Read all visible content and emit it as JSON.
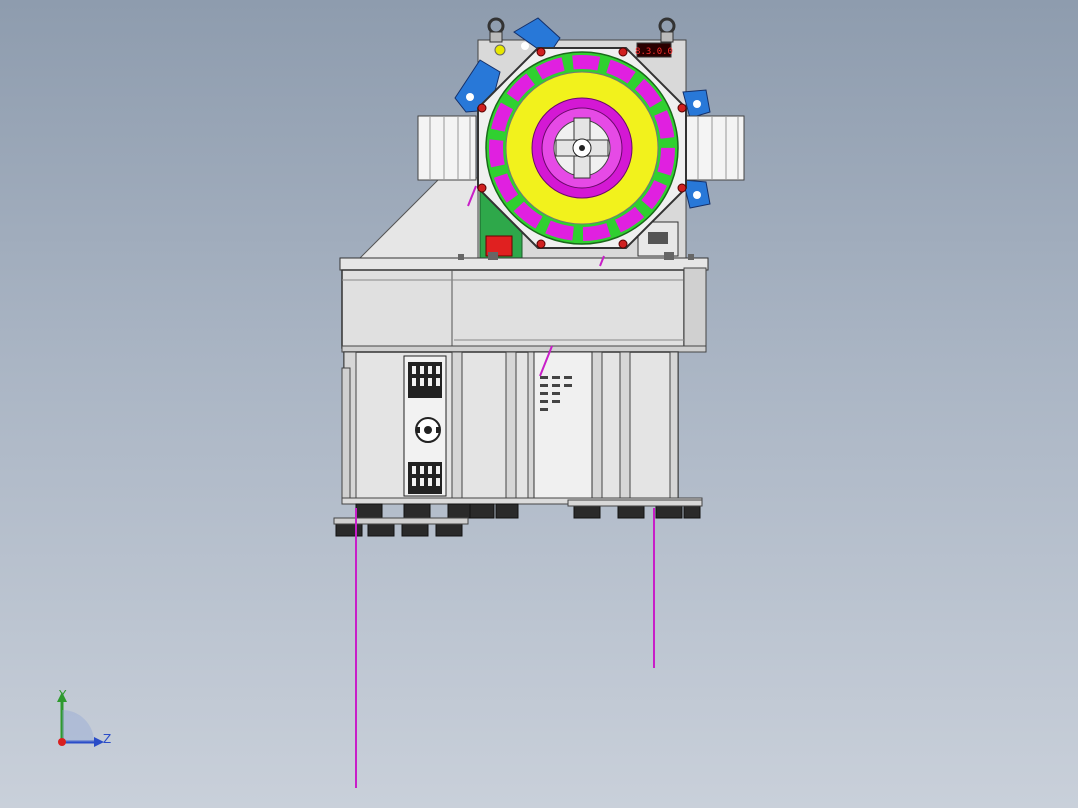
{
  "viewport": {
    "background_top": "#8e9cae",
    "background_bottom": "#c9d0da"
  },
  "model": {
    "parts": [
      "lifting-eye",
      "octagon-frame",
      "rotor",
      "stator-ring",
      "brake-drum",
      "cooling-fan",
      "base-plate",
      "lower-frame",
      "pink-cable"
    ],
    "colors": {
      "rotor": "#f2f21c",
      "magnet": "#e020e0",
      "stator_segment": "#30d030",
      "frame": "#f0f0f0",
      "brake_mount": "#2878d8",
      "stator_back": "#2ea84a",
      "warning_box": "#e02020",
      "fastener": "#d02020",
      "cable": "#c81ec8"
    },
    "display_text": "8.3.0.0"
  },
  "triad": {
    "y_label": "Y",
    "z_label": "Z",
    "y_color": "#2e9a2e",
    "z_color": "#2a4cc8",
    "x_color": "#d82020"
  }
}
